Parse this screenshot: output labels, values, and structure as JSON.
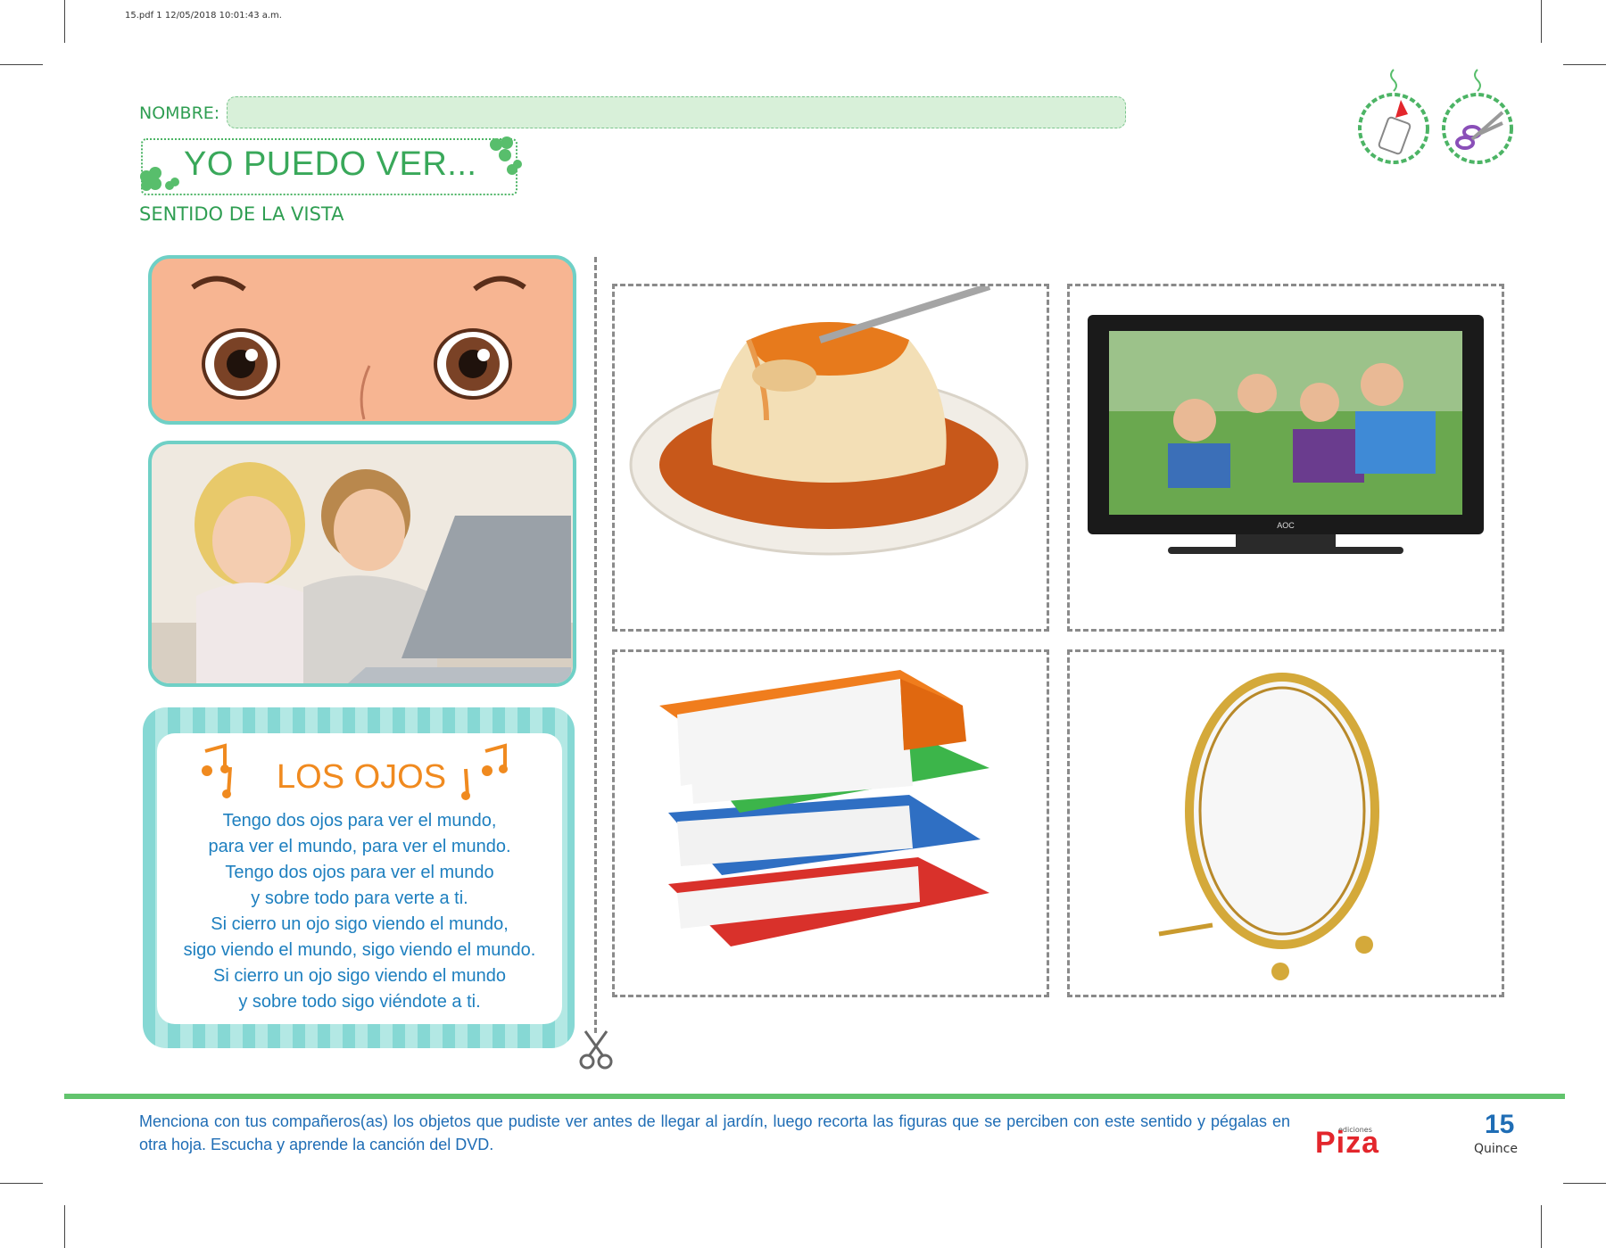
{
  "print_info": "15.pdf   1   12/05/2018   10:01:43 a.m.",
  "header": {
    "name_label": "NOMBRE:",
    "title": "YO PUEDO VER...",
    "subtitle": "SENTIDO DE LA VISTA"
  },
  "top_icons": [
    "glue-icon",
    "scissors-icon"
  ],
  "left_panels": [
    "eyes-illustration",
    "children-with-laptop-photo"
  ],
  "song": {
    "title": "LOS OJOS",
    "lines": [
      "Tengo dos ojos para ver el mundo,",
      "para ver el mundo, para ver el mundo.",
      "Tengo dos ojos para ver el mundo",
      "y sobre todo para verte a ti.",
      "Si cierro un ojo sigo viendo el mundo,",
      "sigo viendo el mundo, sigo viendo el mundo.",
      "Si cierro un ojo sigo viendo el mundo",
      "y sobre todo sigo viéndote a ti."
    ]
  },
  "cutouts": [
    {
      "name": "flan-image"
    },
    {
      "name": "television-image",
      "tv_brand": "AOC"
    },
    {
      "name": "books-image"
    },
    {
      "name": "mirror-image"
    }
  ],
  "footer": {
    "instructions": "Menciona con tus compañeros(as) los objetos que pudiste ver antes de llegar al jardín, luego recorta las figuras que se perciben con este sentido y pégalas en otra hoja. Escucha y aprende la canción del DVD.",
    "brand_small": "ediciones",
    "brand": "Piza",
    "page_number": "15",
    "page_word": "Quince"
  },
  "colors": {
    "green": "#39a85a",
    "teal": "#6fd0c6",
    "orange": "#f08a1f",
    "blue": "#1f6db5",
    "red": "#e3262c"
  }
}
